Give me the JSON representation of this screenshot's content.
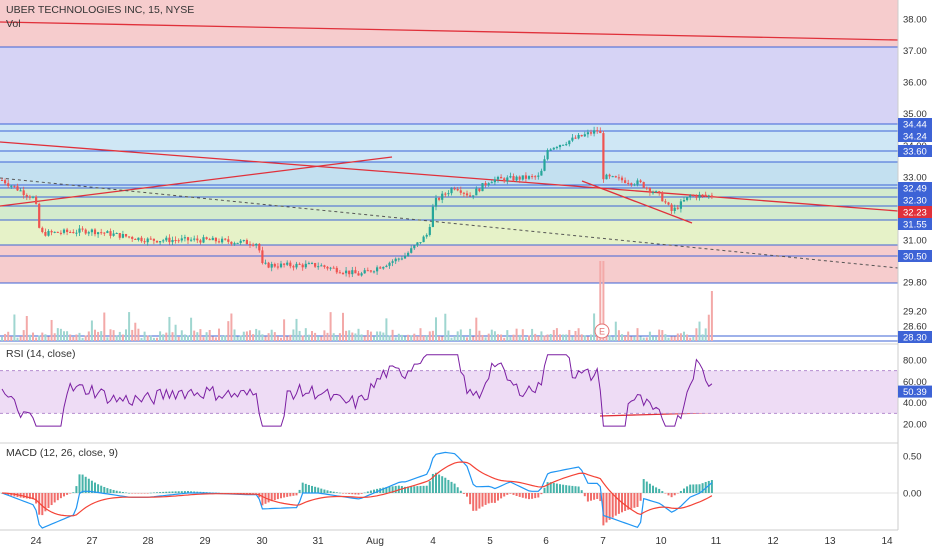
{
  "header": {
    "symbol_title": "UBER TECHNOLOGIES INC, 15, NYSE",
    "volume_label": "Vol"
  },
  "price_axis": {
    "ticks": [
      "38.00",
      "37.00",
      "36.00",
      "35.00",
      "34.00",
      "33.00",
      "32.00",
      "31.00",
      "29.80",
      "29.20",
      "28.60"
    ],
    "tick_values": [
      38.0,
      37.0,
      36.0,
      35.0,
      34.0,
      33.0,
      32.0,
      31.0,
      29.8,
      29.2,
      28.6
    ],
    "highlight_labels": [
      {
        "text": "34.44",
        "value": 34.44,
        "color": "#3d63d6"
      },
      {
        "text": "34.24",
        "value": 34.24,
        "color": "#3d63d6"
      },
      {
        "text": "33.60",
        "value": 33.6,
        "color": "#3d63d6"
      },
      {
        "text": "32.49",
        "value": 32.49,
        "color": "#3d63d6"
      },
      {
        "text": "32.30",
        "value": 32.3,
        "color": "#3d63d6"
      },
      {
        "text": "32.23",
        "value": 32.23,
        "color": "#e0303a"
      },
      {
        "text": "31.55",
        "value": 31.55,
        "color": "#3d63d6"
      },
      {
        "text": "30.50",
        "value": 30.5,
        "color": "#3d63d6"
      },
      {
        "text": "28.30",
        "value": 28.3,
        "color": "#3d63d6"
      }
    ]
  },
  "rsi": {
    "label": "RSI (14, close)",
    "ticks": [
      "80.00",
      "60.00",
      "40.00",
      "20.00"
    ],
    "tick_values": [
      80,
      60,
      40,
      20
    ],
    "current": {
      "text": "50.39",
      "value": 50.39,
      "color": "#3d63d6"
    }
  },
  "macd": {
    "label": "MACD (12, 26, close, 9)",
    "ticks": [
      "0.50",
      "0.00"
    ],
    "tick_values": [
      0.5,
      0.0
    ]
  },
  "time_axis": {
    "labels": [
      "24",
      "27",
      "28",
      "29",
      "30",
      "31",
      "Aug",
      "4",
      "5",
      "6",
      "7",
      "10",
      "11",
      "12",
      "13",
      "14"
    ]
  },
  "earnings_marker": "E",
  "colors": {
    "up": "#26a69a",
    "down": "#ef5350",
    "blue_line": "#3d63d6",
    "trend_red": "#e0303a",
    "rsi_line": "#7b1fa2",
    "macd_line": "#2196f3",
    "signal_line": "#f44336",
    "zone_red": "#f6cccd",
    "zone_violet": "#d6d3f5",
    "zone_lightblue": "#cfe7f5",
    "zone_blue": "#c3e0f0",
    "zone_green": "#d3ebcd",
    "zone_lime": "#e6f2c8",
    "rsi_band": "#eedcf5"
  },
  "chart_data": {
    "type": "candlestick",
    "title": "UBER TECHNOLOGIES INC, 15, NYSE",
    "interval": "15",
    "price_range": [
      28.3,
      38.3
    ],
    "time_labels": [
      "24",
      "27",
      "28",
      "29",
      "30",
      "31",
      "Aug",
      "4",
      "5",
      "6",
      "7",
      "10",
      "11",
      "12",
      "13",
      "14"
    ],
    "approx_close_path": [
      {
        "session": "24",
        "close": 32.4
      },
      {
        "session": "27",
        "close": 31.2
      },
      {
        "session": "28",
        "close": 31.0
      },
      {
        "session": "29",
        "close": 31.05
      },
      {
        "session": "30",
        "close": 30.2
      },
      {
        "session": "31",
        "close": 30.0
      },
      {
        "session": "Aug",
        "close": 30.6
      },
      {
        "session": "4",
        "close": 32.7
      },
      {
        "session": "5",
        "close": 32.9
      },
      {
        "session": "6",
        "close": 34.5
      },
      {
        "session": "7",
        "close": 32.8
      },
      {
        "session": "10",
        "close": 32.4
      },
      {
        "session": "11",
        "close": 32.23
      }
    ],
    "horizontal_levels": [
      37.0,
      34.44,
      34.24,
      33.6,
      32.49,
      32.3,
      31.55,
      30.5,
      28.3
    ],
    "rsi_range": [
      10,
      90
    ],
    "rsi_levels": [
      70,
      30
    ],
    "macd_range": [
      -0.3,
      0.6
    ],
    "legend": "none",
    "grid": false
  }
}
